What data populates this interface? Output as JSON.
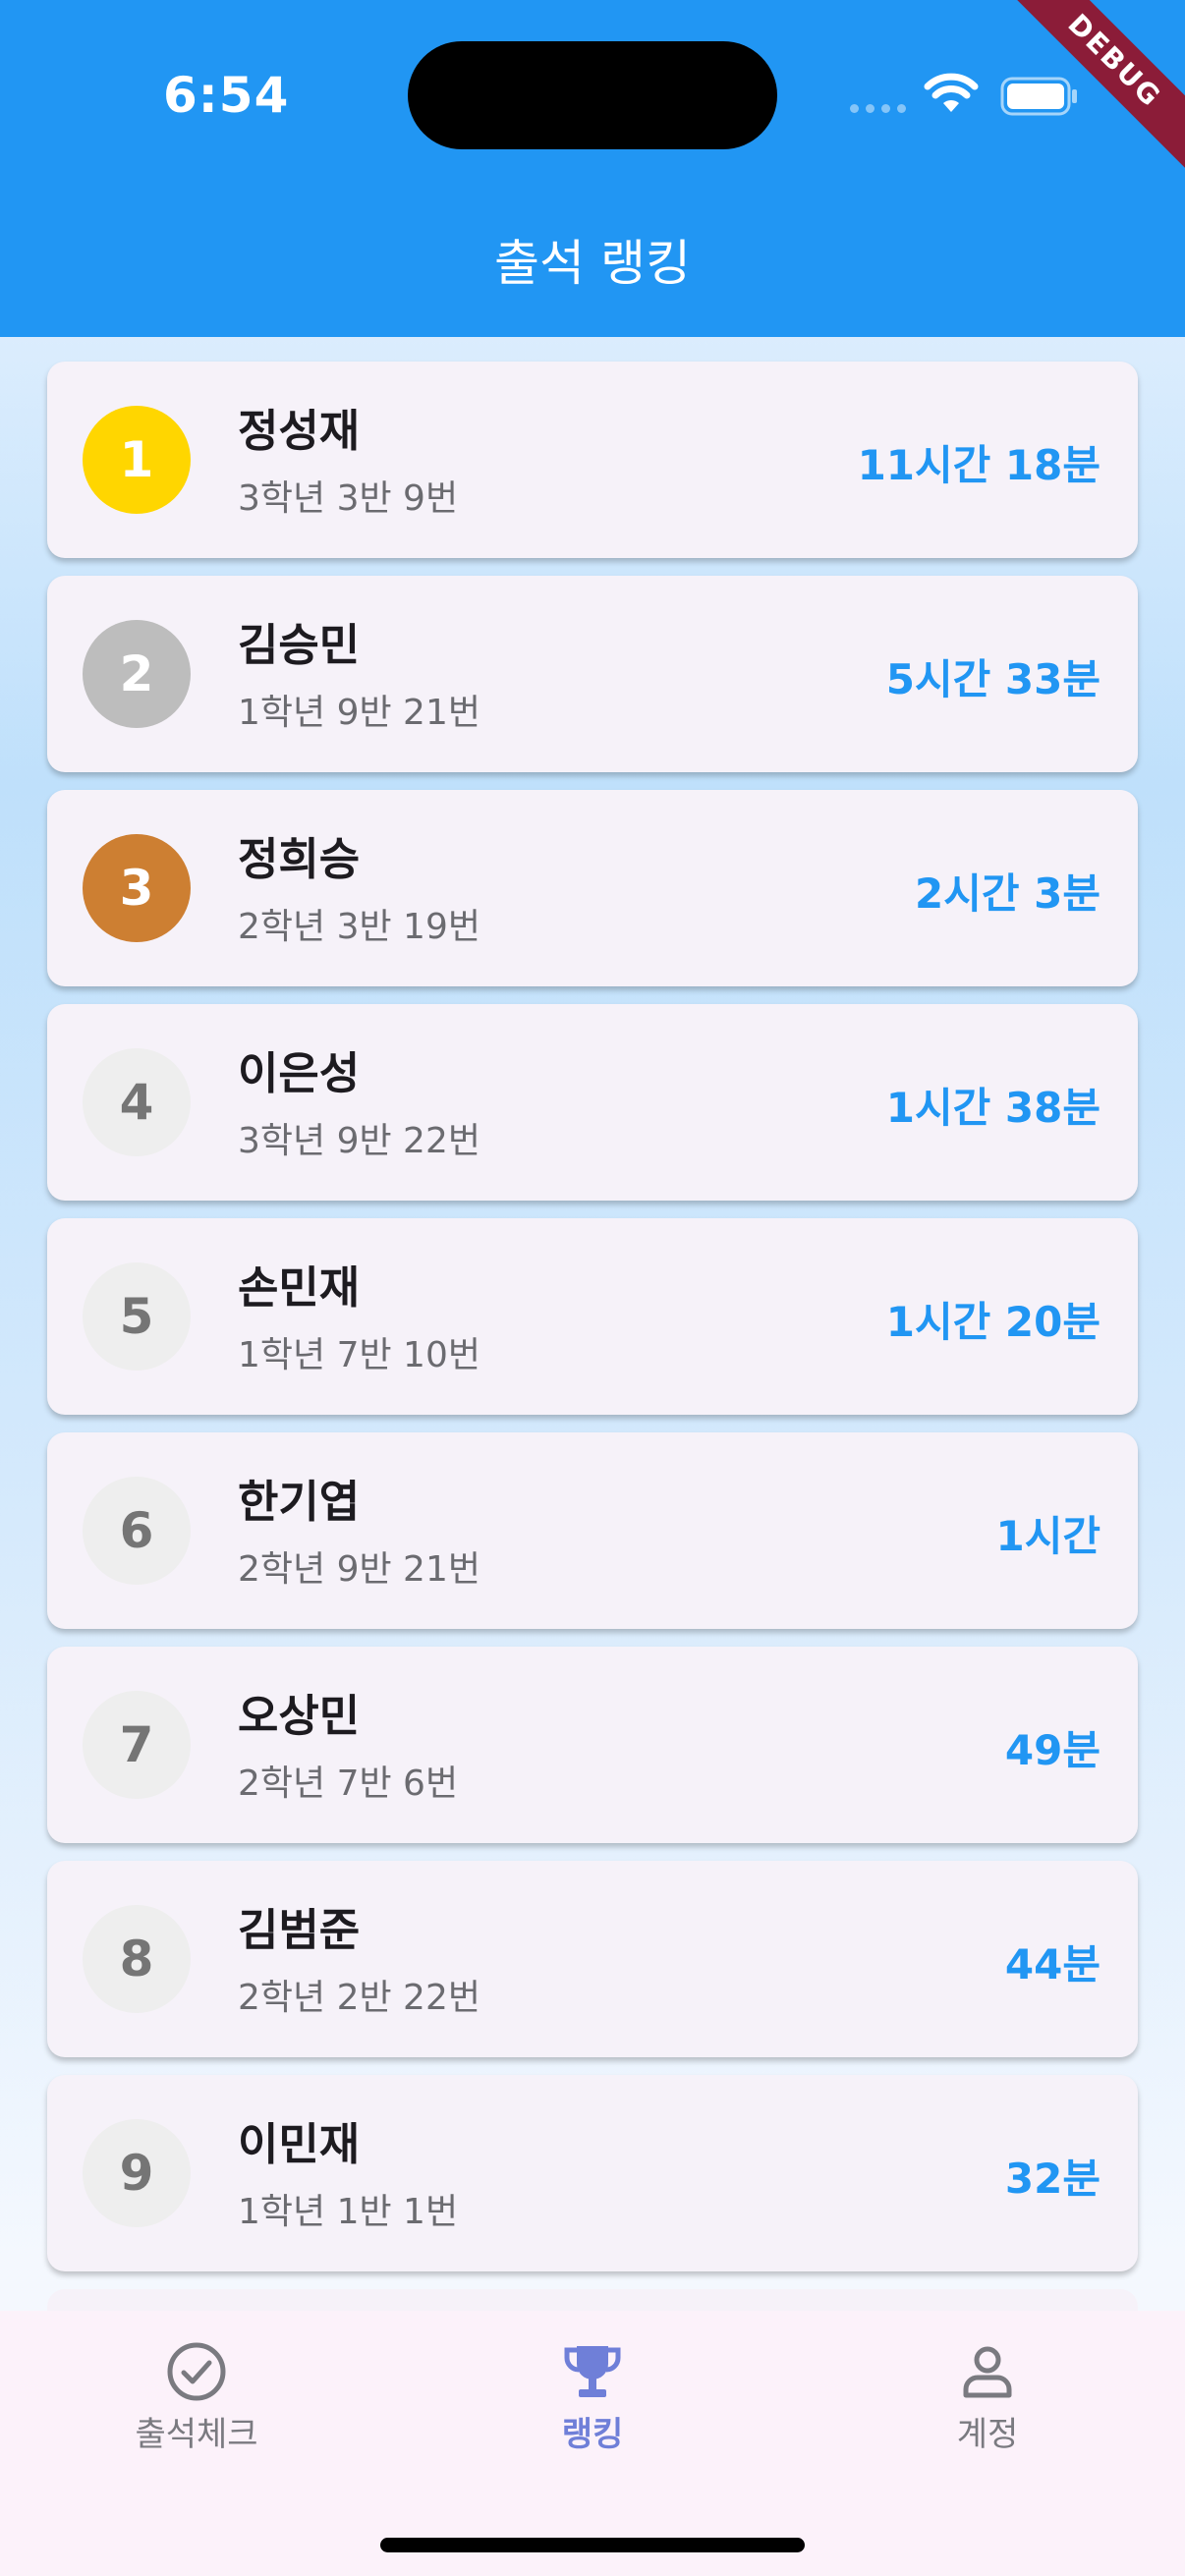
{
  "status_bar": {
    "time": "6:54"
  },
  "debug_banner": "DEBUG",
  "app_bar": {
    "title": "출석 랭킹"
  },
  "ranking": [
    {
      "rank": "1",
      "name": "정성재",
      "info": "3학년 3반 9번",
      "time": "11시간 18분",
      "badge_color": "#FFD600",
      "text_color": "#ffffff"
    },
    {
      "rank": "2",
      "name": "김승민",
      "info": "1학년 9반 21번",
      "time": "5시간 33분",
      "badge_color": "#BDBDBD",
      "text_color": "#ffffff"
    },
    {
      "rank": "3",
      "name": "정희승",
      "info": "2학년 3반 19번",
      "time": "2시간 3분",
      "badge_color": "#CD7F32",
      "text_color": "#ffffff"
    },
    {
      "rank": "4",
      "name": "이은성",
      "info": "3학년 9반 22번",
      "time": "1시간 38분",
      "badge_color": "#EEEEEE",
      "text_color": "#757575"
    },
    {
      "rank": "5",
      "name": "손민재",
      "info": "1학년 7반 10번",
      "time": "1시간 20분",
      "badge_color": "#EEEEEE",
      "text_color": "#757575"
    },
    {
      "rank": "6",
      "name": "한기엽",
      "info": "2학년 9반 21번",
      "time": "1시간",
      "badge_color": "#EEEEEE",
      "text_color": "#757575"
    },
    {
      "rank": "7",
      "name": "오상민",
      "info": "2학년 7반 6번",
      "time": "49분",
      "badge_color": "#EEEEEE",
      "text_color": "#757575"
    },
    {
      "rank": "8",
      "name": "김범준",
      "info": "2학년 2반 22번",
      "time": "44분",
      "badge_color": "#EEEEEE",
      "text_color": "#757575"
    },
    {
      "rank": "9",
      "name": "이민재",
      "info": "1학년 1반 1번",
      "time": "32분",
      "badge_color": "#EEEEEE",
      "text_color": "#757575"
    }
  ],
  "bottom_nav": {
    "items": [
      {
        "label": "출석체크",
        "icon": "check-circle-icon",
        "active": false
      },
      {
        "label": "랭킹",
        "icon": "trophy-icon",
        "active": true
      },
      {
        "label": "계정",
        "icon": "person-icon",
        "active": false
      }
    ]
  },
  "colors": {
    "primary": "#2196f3",
    "nav_active": "#6f7fd8"
  }
}
